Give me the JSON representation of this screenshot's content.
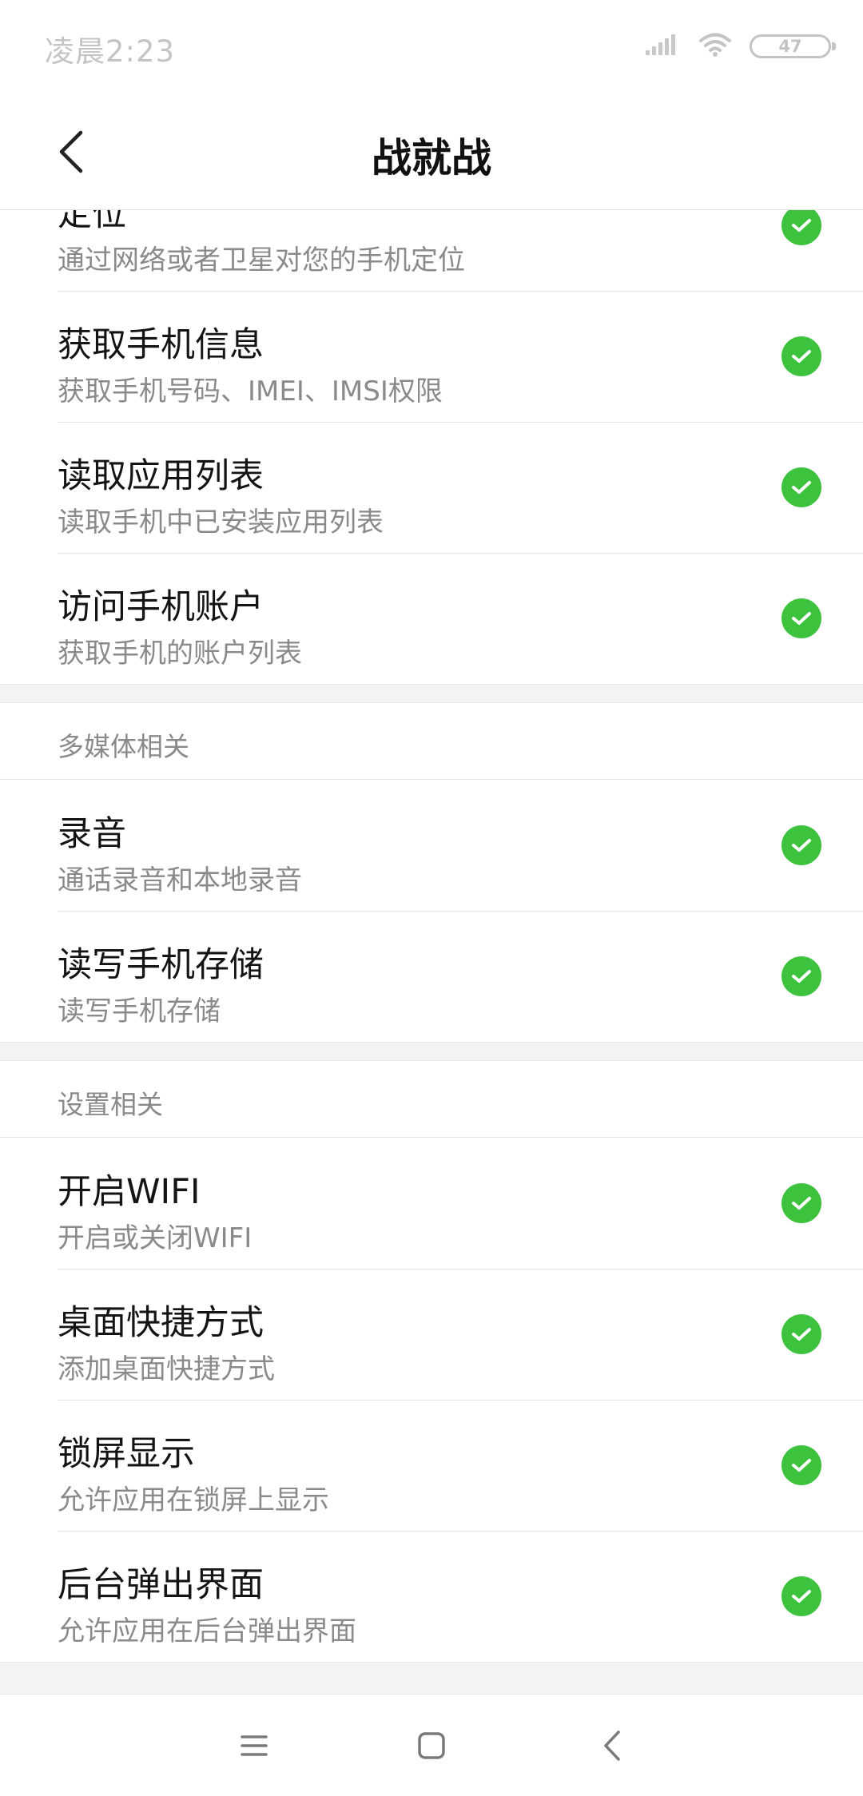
{
  "status_bar": {
    "time": "凌晨2:23",
    "battery_level": "47",
    "icons": [
      "signal-icon",
      "wifi-icon",
      "battery-icon"
    ]
  },
  "header": {
    "title": "战就战",
    "back_icon": "back-chevron-icon"
  },
  "colors": {
    "check": "#3cc23c",
    "title_text": "#141414",
    "subtitle_text": "#8a8a8a",
    "section_bg": "#f4f4f4"
  },
  "permissions": {
    "location": {
      "title": "定位",
      "subtitle": "通过网络或者卫星对您的手机定位"
    },
    "phone_info": {
      "title": "获取手机信息",
      "subtitle": "获取手机号码、IMEI、IMSI权限"
    },
    "app_list": {
      "title": "读取应用列表",
      "subtitle": "读取手机中已安装应用列表"
    },
    "accounts": {
      "title": "访问手机账户",
      "subtitle": "获取手机的账户列表"
    }
  },
  "multimedia": {
    "label": "多媒体相关",
    "record": {
      "title": "录音",
      "subtitle": "通话录音和本地录音"
    },
    "storage": {
      "title": "读写手机存储",
      "subtitle": "读写手机存储"
    }
  },
  "settings": {
    "label": "设置相关",
    "wifi": {
      "title": "开启WIFI",
      "subtitle": "开启或关闭WIFI"
    },
    "shortcut": {
      "title": "桌面快捷方式",
      "subtitle": "添加桌面快捷方式"
    },
    "lockscreen": {
      "title": "锁屏显示",
      "subtitle": "允许应用在锁屏上显示"
    },
    "popup": {
      "title": "后台弹出界面",
      "subtitle": "允许应用在后台弹出界面"
    }
  },
  "nav_bar": {
    "icons": [
      "menu-icon",
      "home-icon",
      "back-icon"
    ]
  }
}
